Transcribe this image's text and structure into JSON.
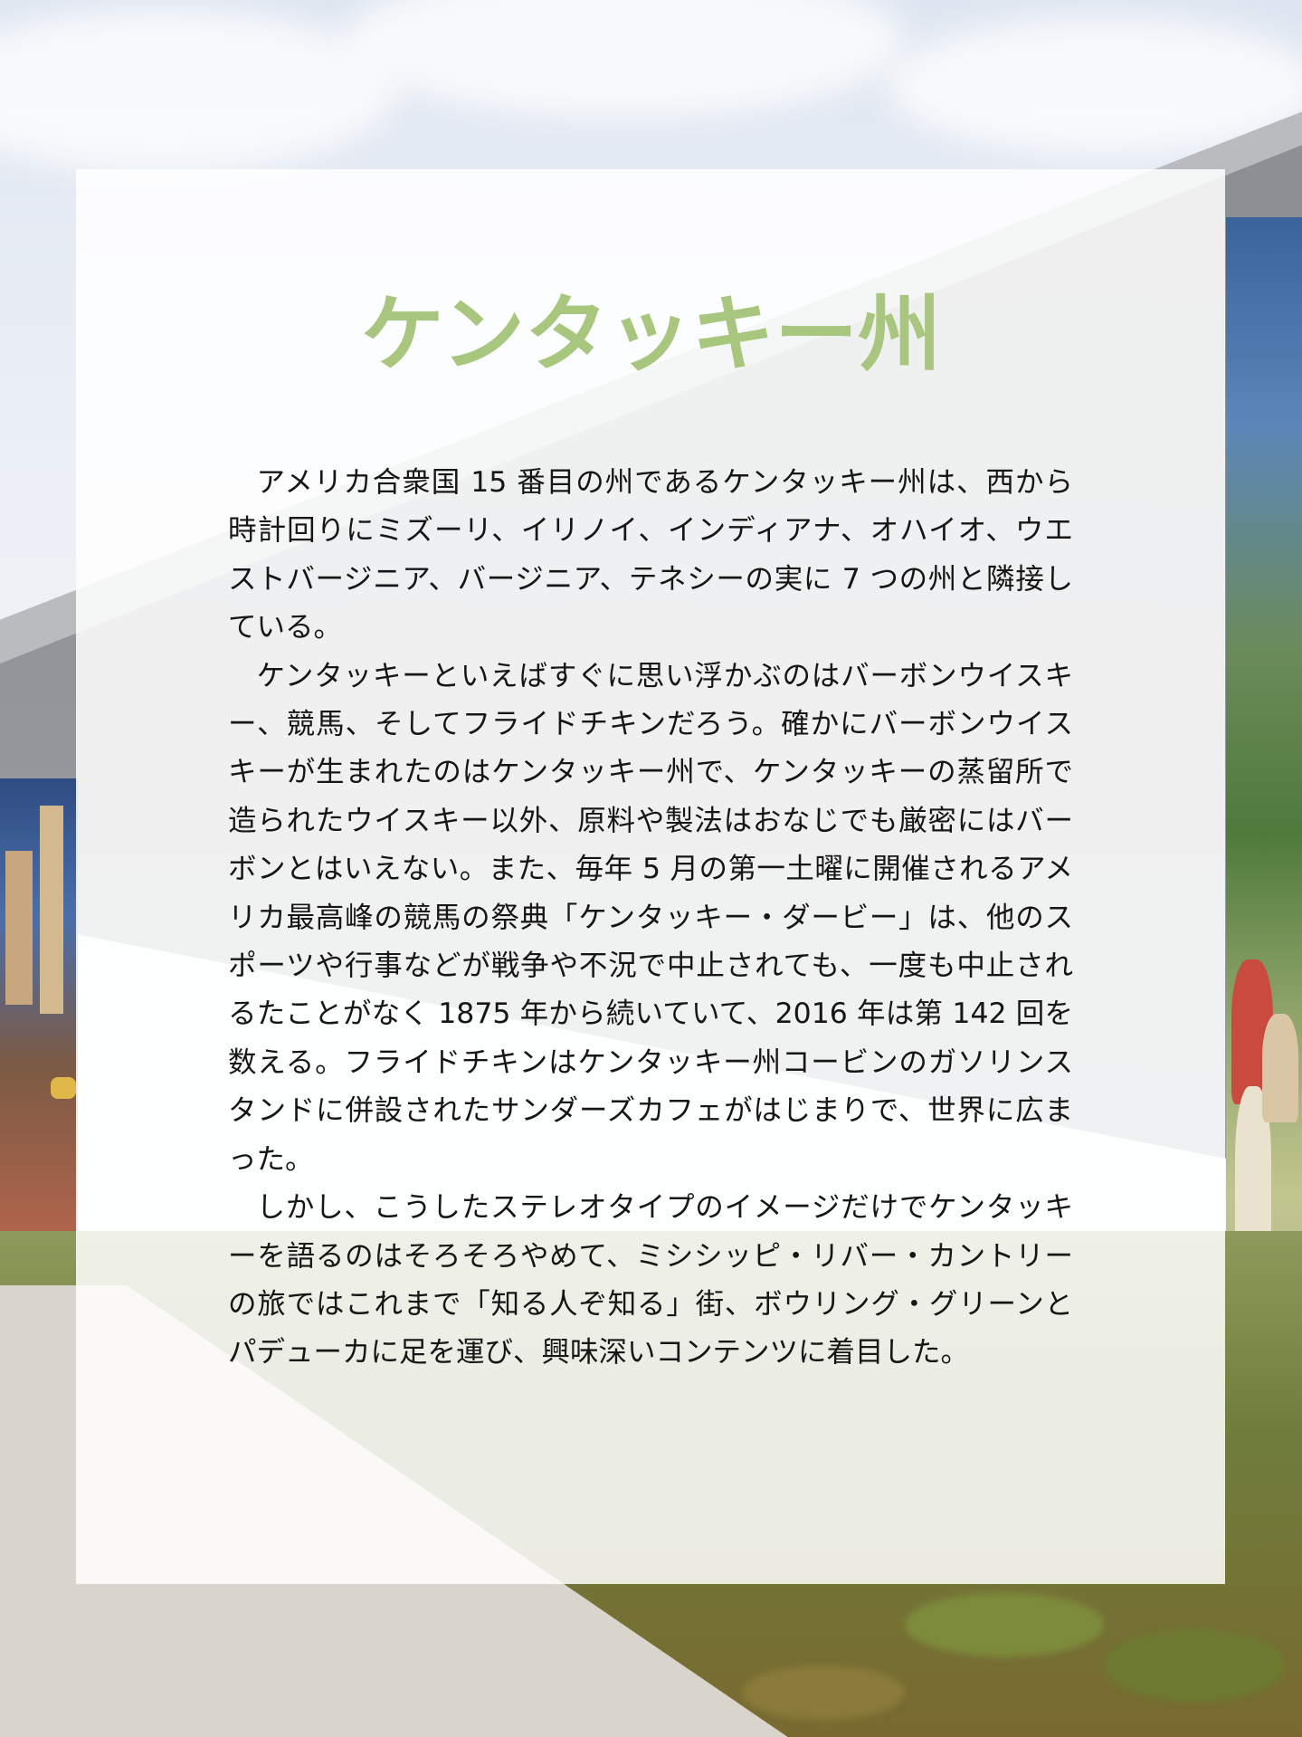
{
  "title": "ケンタッキー州",
  "paragraphs": [
    "アメリカ合衆国 15 番目の州であるケンタッキー州は、西から時計回りにミズーリ、イリノイ、インディアナ、オハイオ、ウエストバージニア、バージニア、テネシーの実に 7 つの州と隣接している。",
    "ケンタッキーといえばすぐに思い浮かぶのはバーボンウイスキー、競馬、そしてフライドチキンだろう。確かにバーボンウイスキーが生まれたのはケンタッキー州で、ケンタッキーの蒸留所で造られたウイスキー以外、原料や製法はおなじでも厳密にはバーボンとはいえない。また、毎年 5 月の第一土曜に開催されるアメリカ最高峰の競馬の祭典「ケンタッキー・ダービー」は、他のスポーツや行事などが戦争や不況で中止されても、一度も中止されるたことがなく 1875 年から続いていて、2016 年は第 142 回を数える。フライドチキンはケンタッキー州コービンのガソリンスタンドに併設されたサンダーズカフェがはじまりで、世界に広まった。",
    "しかし、こうしたステレオタイプのイメージだけでケンタッキーを語るのはそろそろやめて、ミシシッピ・リバー・カントリーの旅ではこれまで「知る人ぞ知る」街、ボウリング・グリーンとパデューカに足を運び、興味深いコンテンツに着目した。"
  ],
  "colors": {
    "title": "#a9c67e",
    "body_text": "#161616",
    "panel": "rgba(255,255,255,0.86)"
  }
}
